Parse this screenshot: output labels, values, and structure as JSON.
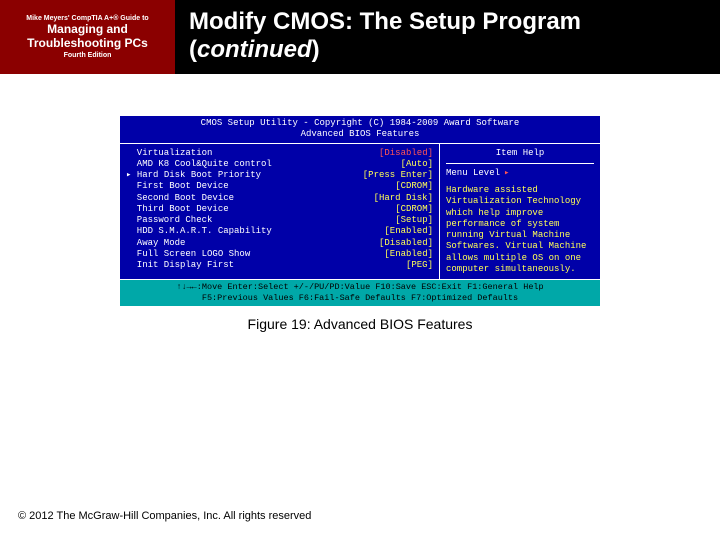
{
  "header": {
    "left_line1": "Mike Meyers' CompTIA A+® Guide to",
    "left_line2": "Managing and Troubleshooting PCs",
    "left_line3": "Fourth Edition",
    "title_a": "Modify CMOS: The Setup Program (",
    "title_b": "continued",
    "title_c": ")"
  },
  "bios": {
    "title1": "CMOS Setup Utility - Copyright (C) 1984-2009 Award Software",
    "title2": "Advanced BIOS Features",
    "rows": [
      {
        "k": "  Virtualization",
        "v": "[Disabled]",
        "sel": true
      },
      {
        "k": "  AMD K8 Cool&Quite control",
        "v": "[Auto]"
      },
      {
        "k": "▸ Hard Disk Boot Priority",
        "v": "[Press Enter]"
      },
      {
        "k": "  First Boot Device",
        "v": "[CDROM]"
      },
      {
        "k": "  Second Boot Device",
        "v": "[Hard Disk]"
      },
      {
        "k": "  Third Boot Device",
        "v": "[CDROM]"
      },
      {
        "k": "  Password Check",
        "v": "[Setup]"
      },
      {
        "k": "  HDD S.M.A.R.T. Capability",
        "v": "[Enabled]"
      },
      {
        "k": "  Away Mode",
        "v": "[Disabled]"
      },
      {
        "k": "  Full Screen LOGO Show",
        "v": "[Enabled]"
      },
      {
        "k": "  Init Display First",
        "v": "[PEG]"
      }
    ],
    "help_title": "Item Help",
    "menu_level": "Menu Level",
    "help_text": "Hardware assisted Virtualization Technology which help improve performance of system running Virtual Machine Softwares.\n\nVirtual Machine allows multiple OS on one computer simultaneously.",
    "foot1": "↑↓→←:Move  Enter:Select  +/-/PU/PD:Value  F10:Save  ESC:Exit  F1:General Help",
    "foot2": "F5:Previous Values  F6:Fail-Safe Defaults  F7:Optimized Defaults"
  },
  "caption": "Figure 19: Advanced BIOS Features",
  "copyright": "© 2012 The McGraw-Hill Companies, Inc. All rights reserved"
}
